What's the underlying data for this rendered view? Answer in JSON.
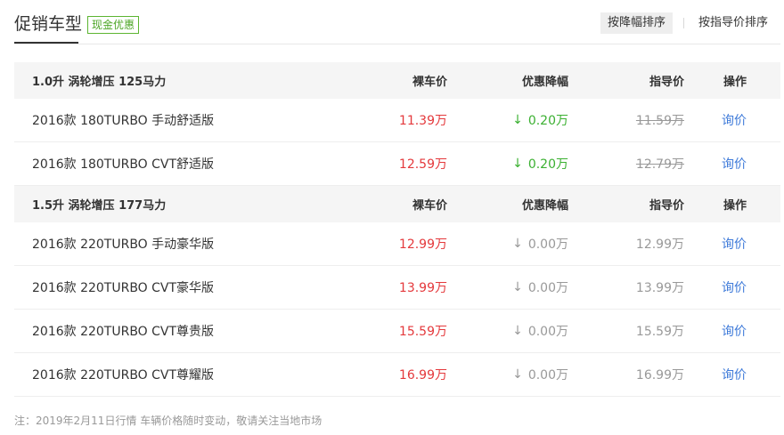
{
  "header": {
    "title": "促销车型",
    "tag": "现金优惠",
    "sort_by_discount": "按降幅排序",
    "sort_by_guide": "按指导价排序"
  },
  "columns": {
    "price": "裸车价",
    "discount": "优惠降幅",
    "guide": "指导价",
    "action": "操作"
  },
  "groups": [
    {
      "name": "1.0升 涡轮增压 125马力",
      "rows": [
        {
          "name": "2016款 180TURBO 手动舒适版",
          "price": "11.39万",
          "discount": "0.20万",
          "guide": "11.59万",
          "action": "询价"
        },
        {
          "name": "2016款 180TURBO CVT舒适版",
          "price": "12.59万",
          "discount": "0.20万",
          "guide": "12.79万",
          "action": "询价"
        }
      ]
    },
    {
      "name": "1.5升 涡轮增压 177马力",
      "rows": [
        {
          "name": "2016款 220TURBO 手动豪华版",
          "price": "12.99万",
          "discount": "0.00万",
          "guide": "12.99万",
          "action": "询价"
        },
        {
          "name": "2016款 220TURBO CVT豪华版",
          "price": "13.99万",
          "discount": "0.00万",
          "guide": "13.99万",
          "action": "询价"
        },
        {
          "name": "2016款 220TURBO CVT尊贵版",
          "price": "15.59万",
          "discount": "0.00万",
          "guide": "15.59万",
          "action": "询价"
        },
        {
          "name": "2016款 220TURBO CVT尊耀版",
          "price": "16.99万",
          "discount": "0.00万",
          "guide": "16.99万",
          "action": "询价"
        }
      ]
    }
  ],
  "footnote": "注：2019年2月11日行情 车辆价格随时变动，敬请关注当地市场",
  "colors": {
    "price": "#e4393c",
    "discount_active": "#3bb031",
    "link": "#3e7ad9"
  }
}
